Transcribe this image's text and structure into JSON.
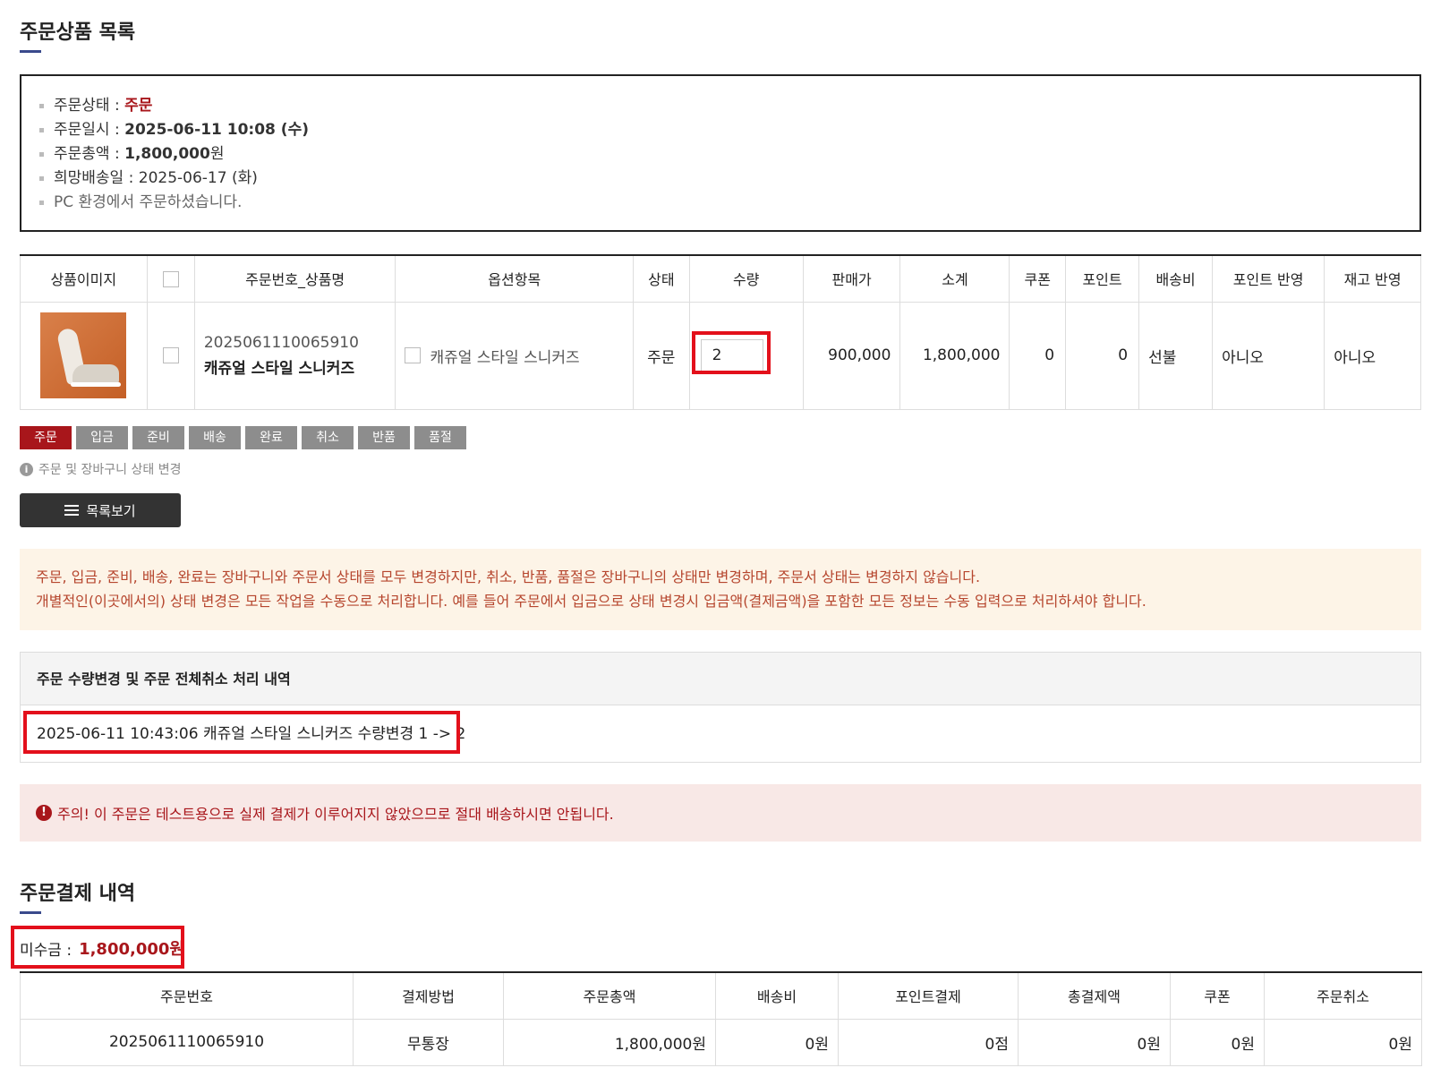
{
  "order_section": {
    "title": "주문상품 목록"
  },
  "order_info": {
    "status_label": "주문상태 : ",
    "status_value": "주문",
    "date_label": "주문일시 : ",
    "date_value": "2025-06-11 10:08 (수)",
    "total_label": "주문총액 : ",
    "total_value": "1,800,000",
    "total_unit": "원",
    "delivery_label": "희망배송일 : ",
    "delivery_value": "2025-06-17 (화)",
    "env_note": "PC 환경에서 주문하셨습니다."
  },
  "product_table": {
    "headers": [
      "상품이미지",
      "주문번호_상품명",
      "옵션항목",
      "상태",
      "수량",
      "판매가",
      "소계",
      "쿠폰",
      "포인트",
      "배송비",
      "포인트 반영",
      "재고 반영"
    ],
    "row": {
      "order_no": "2025061110065910",
      "product_name": "캐쥬얼 스타일 스니커즈",
      "option": "캐쥬얼 스타일 스니커즈",
      "status": "주문",
      "quantity": "2",
      "price": "900,000",
      "subtotal": "1,800,000",
      "coupon": "0",
      "point": "0",
      "shipping": "선불",
      "point_applied": "아니오",
      "stock_applied": "아니오"
    }
  },
  "status_buttons": [
    "주문",
    "입금",
    "준비",
    "배송",
    "완료",
    "취소",
    "반품",
    "품절"
  ],
  "status_note": "주문 및 장바구니 상태 변경",
  "list_button": "목록보기",
  "warning": {
    "line1": "주문, 입금, 준비, 배송, 완료는 장바구니와 주문서 상태를 모두 변경하지만, 취소, 반품, 품절은 장바구니의 상태만 변경하며, 주문서 상태는 변경하지 않습니다.",
    "line2": "개별적인(이곳에서의) 상태 변경은 모든 작업을 수동으로 처리합니다. 예를 들어 주문에서 입금으로 상태 변경시 입금액(결제금액)을 포함한 모든 정보는 수동 입력으로 처리하셔야 합니다."
  },
  "history": {
    "title": "주문 수량변경 및 주문 전체취소 처리 내역",
    "entry": "2025-06-11 10:43:06 캐쥬얼 스타일 스니커즈 수량변경 1 -> 2"
  },
  "alert": "주의! 이 주문은 테스트용으로 실제 결제가 이루어지지 않았으므로 절대 배송하시면 안됩니다.",
  "payment_section": {
    "title": "주문결제 내역"
  },
  "unpaid": {
    "label": "미수금 :",
    "value": "1,800,000원"
  },
  "payment_table": {
    "headers": [
      "주문번호",
      "결제방법",
      "주문총액",
      "배송비",
      "포인트결제",
      "총결제액",
      "쿠폰",
      "주문취소"
    ],
    "row": {
      "order_no": "2025061110065910",
      "method": "무통장",
      "total": "1,800,000원",
      "shipping": "0원",
      "point": "0점",
      "paid": "0원",
      "coupon": "0원",
      "cancel": "0원"
    }
  },
  "colors": {
    "accent_red": "#a8161b",
    "highlight_red": "#e3101b",
    "navy": "#3a4a8c"
  }
}
